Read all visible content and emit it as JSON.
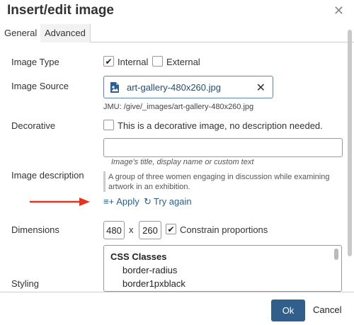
{
  "dialog": {
    "title": "Insert/edit image",
    "close_icon": "close-icon"
  },
  "tabs": [
    {
      "label": "General",
      "active": true
    },
    {
      "label": "Advanced",
      "active": false
    }
  ],
  "image_type": {
    "label": "Image Type",
    "internal_label": "Internal",
    "internal_checked": true,
    "external_label": "External",
    "external_checked": false
  },
  "image_source": {
    "label": "Image Source",
    "file_name": "art-gallery-480x260.jpg",
    "path": "JMU: /give/_images/art-gallery-480x260.jpg"
  },
  "decorative": {
    "label": "Decorative",
    "checkbox_label": "This is a decorative image, no description needed.",
    "checked": false
  },
  "title_field": {
    "value": "",
    "hint": "Image's title, display name or custom text"
  },
  "description": {
    "label": "Image description",
    "text": "A group of three women engaging in discussion while examining artwork in an exhibition.",
    "apply_label": "Apply",
    "retry_label": "Try again"
  },
  "dimensions": {
    "label": "Dimensions",
    "width": "480",
    "separator": "x",
    "height": "260",
    "constrain_label": "Constrain proportions",
    "constrain_checked": true
  },
  "styling": {
    "label": "Styling",
    "list_header": "CSS Classes",
    "options": [
      "border-radius",
      "border1pxblack"
    ]
  },
  "footer": {
    "ok_label": "Ok",
    "cancel_label": "Cancel"
  },
  "colors": {
    "primary_button": "#2f5f8a",
    "link": "#2b5f93",
    "arrow": "#e8321e"
  }
}
